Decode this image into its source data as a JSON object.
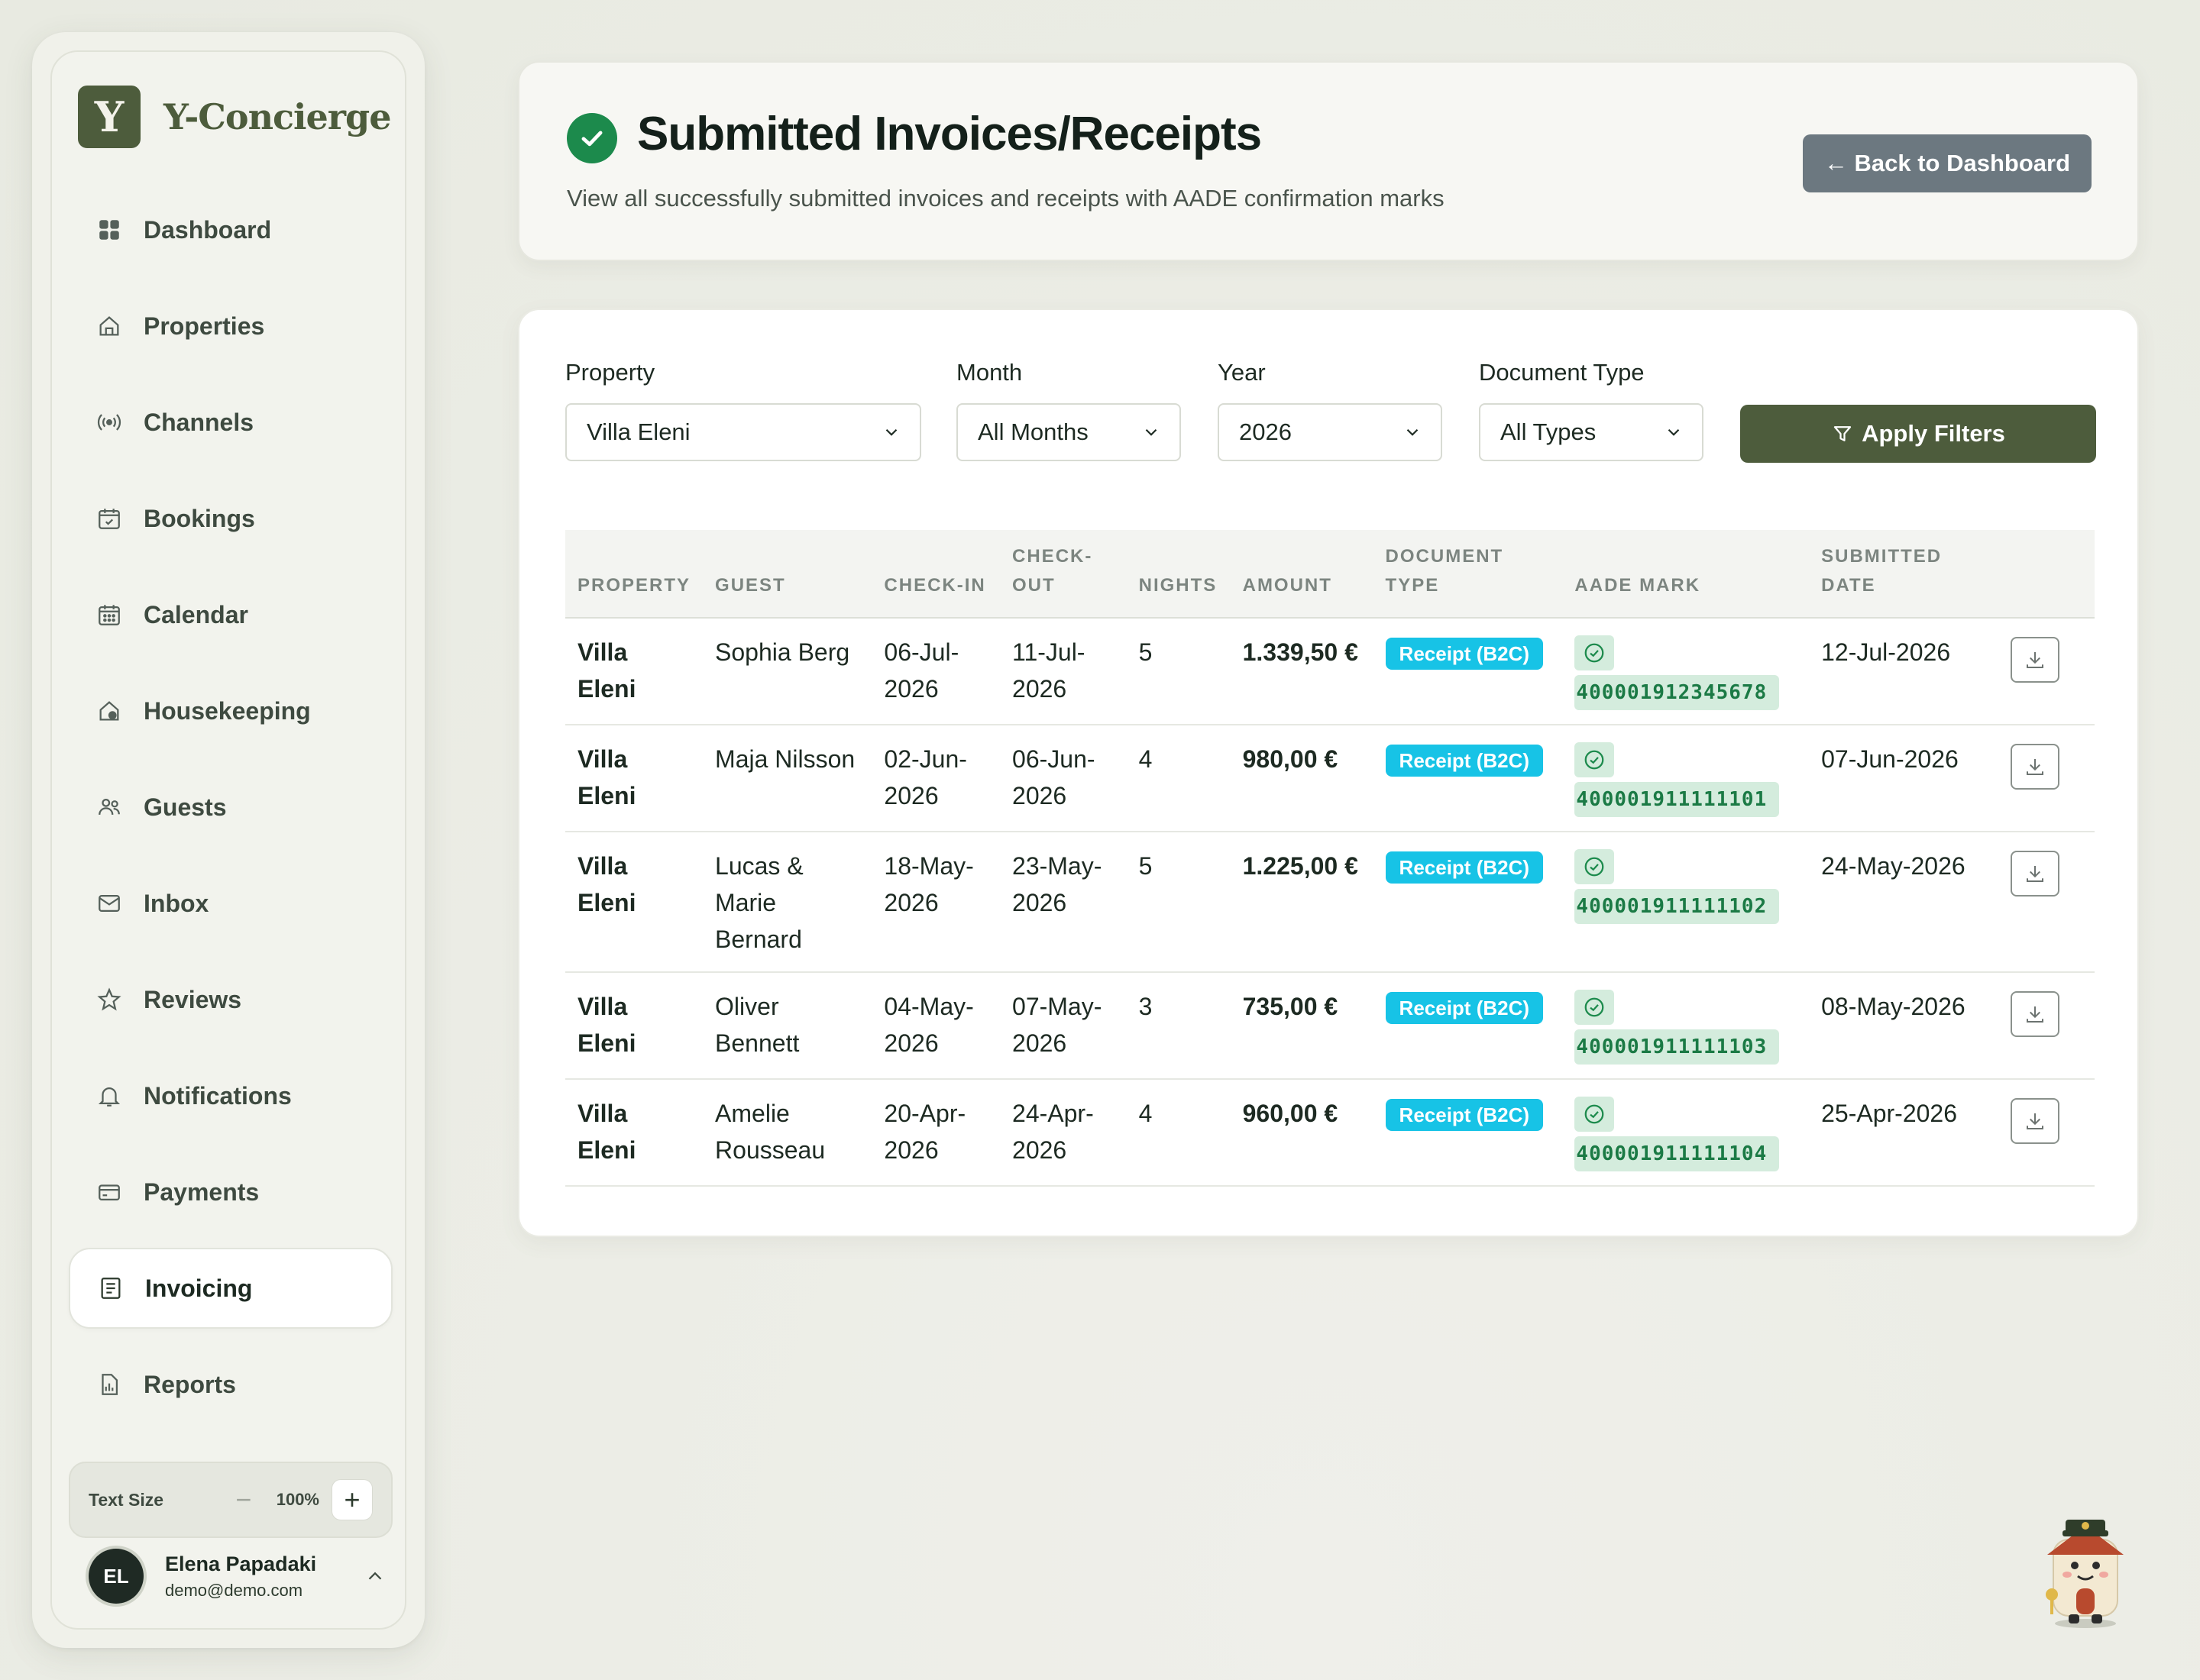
{
  "app": {
    "logo_letter": "Y",
    "name": "Y-Concierge"
  },
  "sidebar": {
    "items": [
      {
        "label": "Dashboard",
        "icon": "grid-icon"
      },
      {
        "label": "Properties",
        "icon": "house-icon"
      },
      {
        "label": "Channels",
        "icon": "broadcast-icon"
      },
      {
        "label": "Bookings",
        "icon": "calendar-check-icon"
      },
      {
        "label": "Calendar",
        "icon": "calendar-grid-icon"
      },
      {
        "label": "Housekeeping",
        "icon": "house-clean-icon"
      },
      {
        "label": "Guests",
        "icon": "users-icon"
      },
      {
        "label": "Inbox",
        "icon": "mail-icon"
      },
      {
        "label": "Reviews",
        "icon": "star-icon"
      },
      {
        "label": "Notifications",
        "icon": "bell-icon"
      },
      {
        "label": "Payments",
        "icon": "credit-card-icon"
      },
      {
        "label": "Invoicing",
        "icon": "receipt-icon",
        "active": true
      },
      {
        "label": "Reports",
        "icon": "report-icon"
      }
    ],
    "text_size": {
      "label": "Text Size",
      "minus": "−",
      "value": "100%",
      "plus": "+"
    },
    "user": {
      "initials": "EL",
      "name": "Elena Papadaki",
      "email": "demo@demo.com"
    }
  },
  "header": {
    "title": "Submitted Invoices/Receipts",
    "subtitle": "View all successfully submitted invoices and receipts with AADE confirmation marks",
    "back_button": "← Back to Dashboard"
  },
  "filters": {
    "property": {
      "label": "Property",
      "value": "Villa Eleni"
    },
    "month": {
      "label": "Month",
      "value": "All Months"
    },
    "year": {
      "label": "Year",
      "value": "2026"
    },
    "doc_type": {
      "label": "Document Type",
      "value": "All Types"
    },
    "apply_label": "Apply Filters"
  },
  "table": {
    "headers": {
      "property": "PROPERTY",
      "guest": "GUEST",
      "checkin": "CHECK-IN",
      "checkout": "CHECK-OUT",
      "nights": "NIGHTS",
      "amount": "AMOUNT",
      "doc_type": "DOCUMENT TYPE",
      "aade_mark": "AADE MARK",
      "submitted": "SUBMITTED DATE"
    },
    "rows": [
      {
        "property": "Villa Eleni",
        "guest": "Sophia Berg",
        "checkin": "06-Jul-2026",
        "checkout": "11-Jul-2026",
        "nights": "5",
        "amount": "1.339,50 €",
        "doc_type": "Receipt (B2C)",
        "mark": "400001912345678",
        "submitted": "12-Jul-2026"
      },
      {
        "property": "Villa Eleni",
        "guest": "Maja Nilsson",
        "checkin": "02-Jun-2026",
        "checkout": "06-Jun-2026",
        "nights": "4",
        "amount": "980,00 €",
        "doc_type": "Receipt (B2C)",
        "mark": "400001911111101",
        "submitted": "07-Jun-2026"
      },
      {
        "property": "Villa Eleni",
        "guest": "Lucas & Marie Bernard",
        "checkin": "18-May-2026",
        "checkout": "23-May-2026",
        "nights": "5",
        "amount": "1.225,00 €",
        "doc_type": "Receipt (B2C)",
        "mark": "400001911111102",
        "submitted": "24-May-2026"
      },
      {
        "property": "Villa Eleni",
        "guest": "Oliver Bennett",
        "checkin": "04-May-2026",
        "checkout": "07-May-2026",
        "nights": "3",
        "amount": "735,00 €",
        "doc_type": "Receipt (B2C)",
        "mark": "400001911111103",
        "submitted": "08-May-2026"
      },
      {
        "property": "Villa Eleni",
        "guest": "Amelie Rousseau",
        "checkin": "20-Apr-2026",
        "checkout": "24-Apr-2026",
        "nights": "4",
        "amount": "960,00 €",
        "doc_type": "Receipt (B2C)",
        "mark": "400001911111104",
        "submitted": "25-Apr-2026"
      }
    ]
  },
  "colors": {
    "brand": "#4d5c3c",
    "success": "#1c8a4c",
    "badge": "#17c3e6",
    "mark_bg": "#d4ecdd",
    "back_button": "#6c7880"
  }
}
